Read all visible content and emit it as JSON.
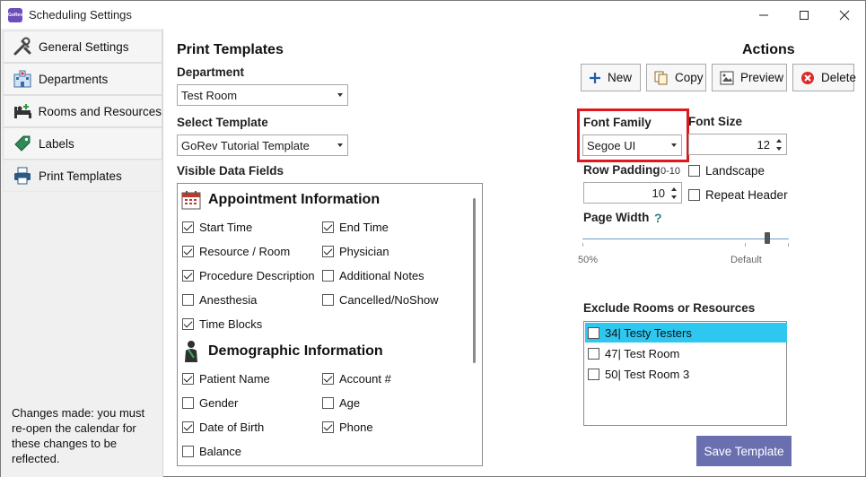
{
  "window": {
    "title": "Scheduling Settings",
    "app_icon_text": "GoRev"
  },
  "sidebar": {
    "items": [
      {
        "label": "General Settings",
        "icon": "tools-icon"
      },
      {
        "label": "Departments",
        "icon": "hospital-icon"
      },
      {
        "label": "Rooms and Resources",
        "icon": "bed-icon"
      },
      {
        "label": "Labels",
        "icon": "tag-icon"
      },
      {
        "label": "Print Templates",
        "icon": "printer-icon",
        "active": true
      }
    ],
    "note": "Changes made: you must re-open the calendar for these changes to be reflected."
  },
  "print_templates": {
    "title": "Print Templates",
    "department_label": "Department",
    "department_value": "Test Room",
    "select_template_label": "Select Template",
    "template_value": "GoRev Tutorial Template",
    "visible_fields_label": "Visible Data Fields",
    "groups": [
      {
        "title": "Appointment Information",
        "icon": "calendar-icon",
        "fields": [
          {
            "label": "Start Time",
            "checked": true
          },
          {
            "label": "End Time",
            "checked": true
          },
          {
            "label": "Resource / Room",
            "checked": true
          },
          {
            "label": "Physician",
            "checked": true
          },
          {
            "label": "Procedure Description",
            "checked": true
          },
          {
            "label": "Additional Notes",
            "checked": false
          },
          {
            "label": "Anesthesia",
            "checked": false
          },
          {
            "label": "Cancelled/NoShow",
            "checked": false
          },
          {
            "label": "Time Blocks",
            "checked": true
          }
        ]
      },
      {
        "title": "Demographic Information",
        "icon": "patient-icon",
        "fields": [
          {
            "label": "Patient Name",
            "checked": true
          },
          {
            "label": "Account #",
            "checked": true
          },
          {
            "label": "Gender",
            "checked": false
          },
          {
            "label": "Age",
            "checked": false
          },
          {
            "label": "Date of Birth",
            "checked": true
          },
          {
            "label": "Phone",
            "checked": true
          },
          {
            "label": "Balance",
            "checked": false
          }
        ]
      }
    ]
  },
  "actions": {
    "title": "Actions",
    "new_label": "New",
    "copy_label": "Copy",
    "preview_label": "Preview",
    "delete_label": "Delete",
    "font_family_label": "Font Family",
    "font_family_value": "Segoe UI",
    "font_size_label": "Font Size",
    "font_size_value": "12",
    "row_padding_label": "Row Padding",
    "row_padding_range": "0-10",
    "row_padding_value": "10",
    "landscape_label": "Landscape",
    "landscape_checked": false,
    "repeat_header_label": "Repeat Header",
    "repeat_header_checked": false,
    "page_width_label": "Page Width",
    "page_width_help": "?",
    "page_width_min_label": "50%",
    "page_width_default_label": "Default",
    "page_width_level": 0.9,
    "exclude_label": "Exclude Rooms or Resources",
    "exclude_items": [
      {
        "label": "34| Testy Testers",
        "checked": false,
        "selected": true
      },
      {
        "label": "47| Test Room",
        "checked": false,
        "selected": false
      },
      {
        "label": "50| Test Room 3",
        "checked": false,
        "selected": false
      }
    ],
    "save_label": "Save Template"
  },
  "colors": {
    "highlight": "#e0181e",
    "selected_row": "#2ec7f0",
    "save_button": "#6a6fb0",
    "app_icon": "#6b4fbb"
  }
}
